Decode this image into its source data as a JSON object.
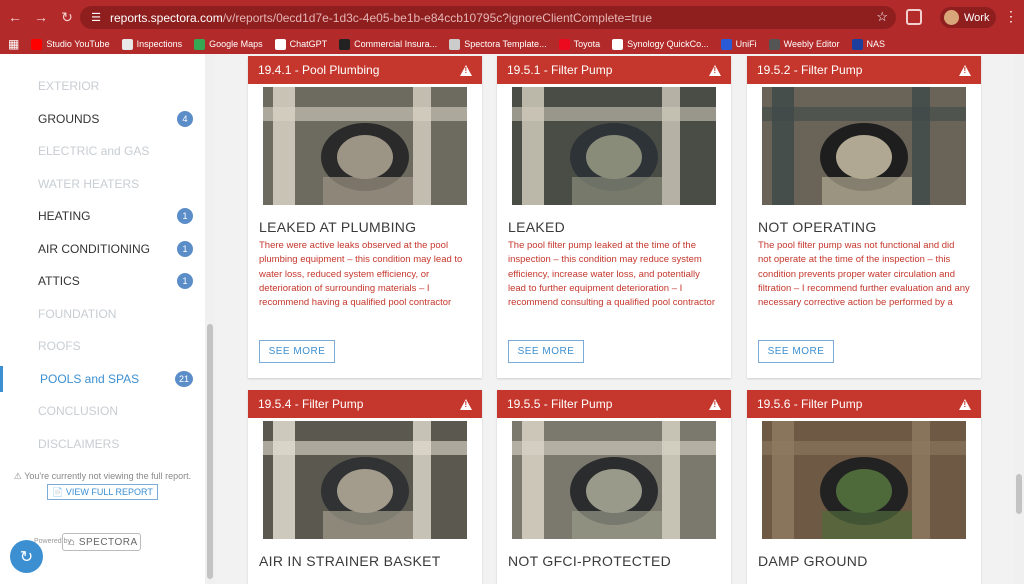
{
  "browser": {
    "url_host": "reports.spectora.com",
    "url_path": "/v/reports/0ecd1d7e-1d3c-4e05-be1b-e84ccb10795c?ignoreClientComplete=true",
    "profile_label": "Work",
    "bookmarks": [
      "Studio YouTube",
      "Inspections",
      "Google Maps",
      "ChatGPT",
      "Commercial Insura...",
      "Spectora Template...",
      "Toyota",
      "Synology QuickCo...",
      "UniFi",
      "Weebly Editor",
      "NAS"
    ],
    "bookmark_colors": [
      "#ff0000",
      "#e8e8e8",
      "#34a853",
      "#ffffff",
      "#222222",
      "#cccccc",
      "#eb0a1e",
      "#ffffff",
      "#2a5bd7",
      "#555555",
      "#1d3e9c"
    ]
  },
  "sidebar": {
    "items": [
      {
        "label": "EXTERIOR",
        "badge": "",
        "state": "dim"
      },
      {
        "label": "GROUNDS",
        "badge": "4",
        "state": "active"
      },
      {
        "label": "ELECTRIC and GAS",
        "badge": "",
        "state": "dim"
      },
      {
        "label": "WATER HEATERS",
        "badge": "",
        "state": "dim"
      },
      {
        "label": "HEATING",
        "badge": "1",
        "state": "active"
      },
      {
        "label": "AIR CONDITIONING",
        "badge": "1",
        "state": "active"
      },
      {
        "label": "ATTICS",
        "badge": "1",
        "state": "active"
      },
      {
        "label": "FOUNDATION",
        "badge": "",
        "state": "dim"
      },
      {
        "label": "ROOFS",
        "badge": "",
        "state": "dim"
      },
      {
        "label": "POOLS and SPAS",
        "badge": "21",
        "state": "current"
      },
      {
        "label": "CONCLUSION",
        "badge": "",
        "state": "dim"
      },
      {
        "label": "DISCLAIMERS",
        "badge": "",
        "state": "dim"
      }
    ],
    "notice": "You're currently not viewing the full report.",
    "view_full_label": "VIEW FULL REPORT",
    "powered_by": "Powered by",
    "brand": "SPECTORA"
  },
  "cards": [
    {
      "header": "19.4.1 - Pool Plumbing",
      "title": "LEAKED AT PLUMBING",
      "body": "There were active leaks observed at the pool plumbing equipment – this condition may lead to water loss, reduced system efficiency, or deterioration of surrounding materials – I recommend having a qualified pool contractor evaluate and perform necessary corrective action.",
      "see_more": "SEE MORE"
    },
    {
      "header": "19.5.1 - Filter Pump",
      "title": "LEAKED",
      "body": "The pool filter pump leaked at the time of the inspection – this condition may reduce system efficiency, increase water loss, and potentially lead to further equipment deterioration – I recommend consulting a qualified pool contractor to evaluate and perform necessary corrective action.",
      "see_more": "SEE MORE"
    },
    {
      "header": "19.5.2 - Filter Pump",
      "title": "NOT OPERATING",
      "body": "The pool filter pump was not functional and did not operate at the time of the inspection – this condition prevents proper water circulation and filtration – I recommend further evaluation and any necessary corrective action be performed by a qualified pool contractor.",
      "see_more": "SEE MORE"
    },
    {
      "header": "19.5.4 - Filter Pump",
      "title": "AIR IN STRAINER BASKET",
      "body": "",
      "see_more": ""
    },
    {
      "header": "19.5.5 - Filter Pump",
      "title": "NOT GFCI-PROTECTED",
      "body": "",
      "see_more": ""
    },
    {
      "header": "19.5.6 - Filter Pump",
      "title": "DAMP GROUND",
      "body": "",
      "see_more": ""
    }
  ],
  "colors": {
    "chrome": "#b32a2a",
    "card_header": "#c5372c",
    "link_blue": "#3c8fd0",
    "badge": "#5b8ec9"
  }
}
